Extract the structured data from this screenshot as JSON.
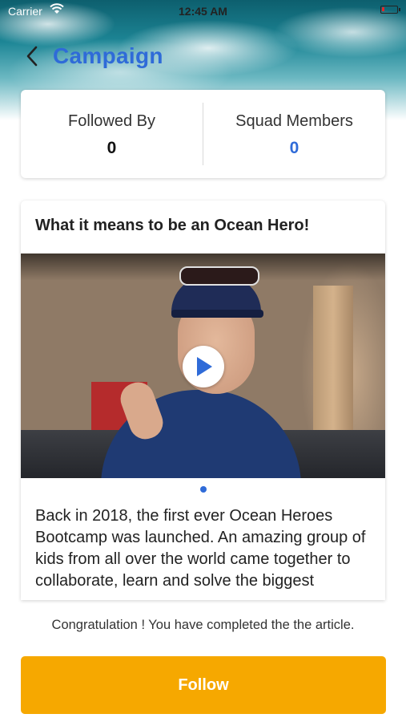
{
  "status_bar": {
    "carrier": "Carrier",
    "time": "12:45 AM"
  },
  "nav": {
    "title": "Campaign"
  },
  "stats": {
    "followed_by_label": "Followed By",
    "followed_by_value": "0",
    "squad_members_label": "Squad Members",
    "squad_members_value": "0"
  },
  "article": {
    "title": "What it means to be an Ocean Hero!",
    "body": "Back in 2018, the first ever Ocean Heroes Bootcamp was launched.  An amazing group of kids from all over the world came together to collaborate, learn and solve the biggest"
  },
  "footer": {
    "congrats_text": "Congratulation ! You have completed the the article.",
    "follow_label": "Follow"
  },
  "colors": {
    "accent_blue": "#2f6bd8",
    "follow_orange": "#f6a800"
  },
  "icons": [
    "wifi-icon",
    "battery-icon",
    "back-chevron-icon",
    "play-icon"
  ]
}
